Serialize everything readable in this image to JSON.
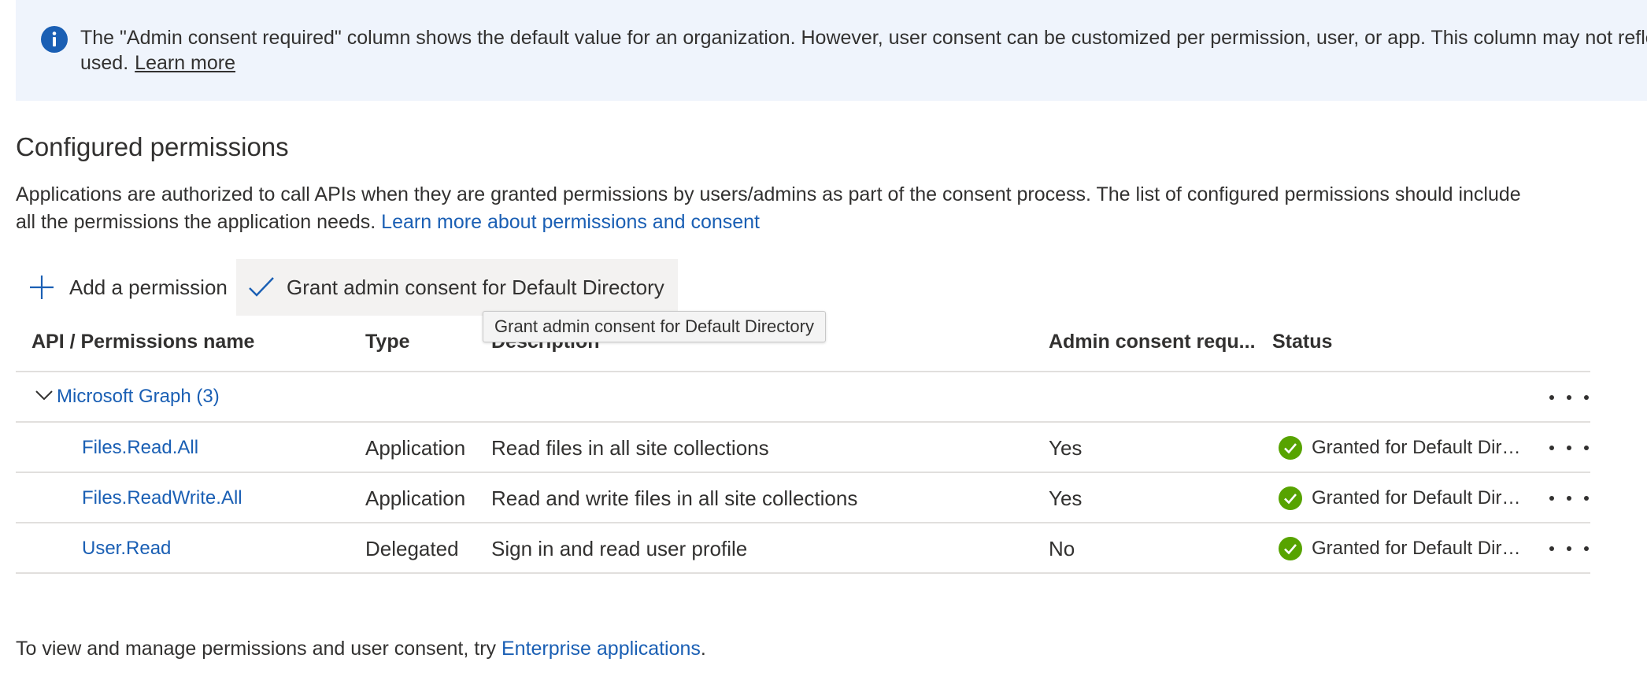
{
  "banner": {
    "line1": "The \"Admin consent required\" column shows the default value for an organization. However, user consent can be customized per permission, user, or app. This column may not reflect the value in your organization, or in organizations where this app will be",
    "line2": "used.",
    "learn_more": "Learn more",
    "icon": "info-icon"
  },
  "section": {
    "title": "Configured permissions",
    "desc_line1": "Applications are authorized to call APIs when they are granted permissions by users/admins as part of the consent process. The list of configured permissions should include",
    "desc_line2": "all the permissions the application needs.",
    "desc_link": "Learn more about permissions and consent"
  },
  "toolbar": {
    "add_label": "Add a permission",
    "grant_label": "Grant admin consent for Default Directory",
    "tooltip": "Grant admin consent for Default Directory"
  },
  "table": {
    "headers": {
      "name": "API / Permissions name",
      "type": "Type",
      "description": "Description",
      "admin": "Admin consent requ...",
      "status": "Status"
    },
    "group": {
      "label": "Microsoft Graph (3)"
    },
    "rows": [
      {
        "name": "Files.Read.All",
        "type": "Application",
        "description": "Read files in all site collections",
        "admin": "Yes",
        "status": "Granted for Default Directory"
      },
      {
        "name": "Files.ReadWrite.All",
        "type": "Application",
        "description": "Read and write files in all site collections",
        "admin": "Yes",
        "status": "Granted for Default Directory"
      },
      {
        "name": "User.Read",
        "type": "Delegated",
        "description": "Sign in and read user profile",
        "admin": "No",
        "status": "Granted for Default Directory"
      }
    ]
  },
  "footer": {
    "text": "To view and manage permissions and user consent, try",
    "link": "Enterprise applications",
    "period": "."
  },
  "colors": {
    "accent": "#1a5fb4",
    "banner_bg": "#eff4fc",
    "granted_green": "#57a300",
    "info_blue": "#1a5fb4"
  }
}
